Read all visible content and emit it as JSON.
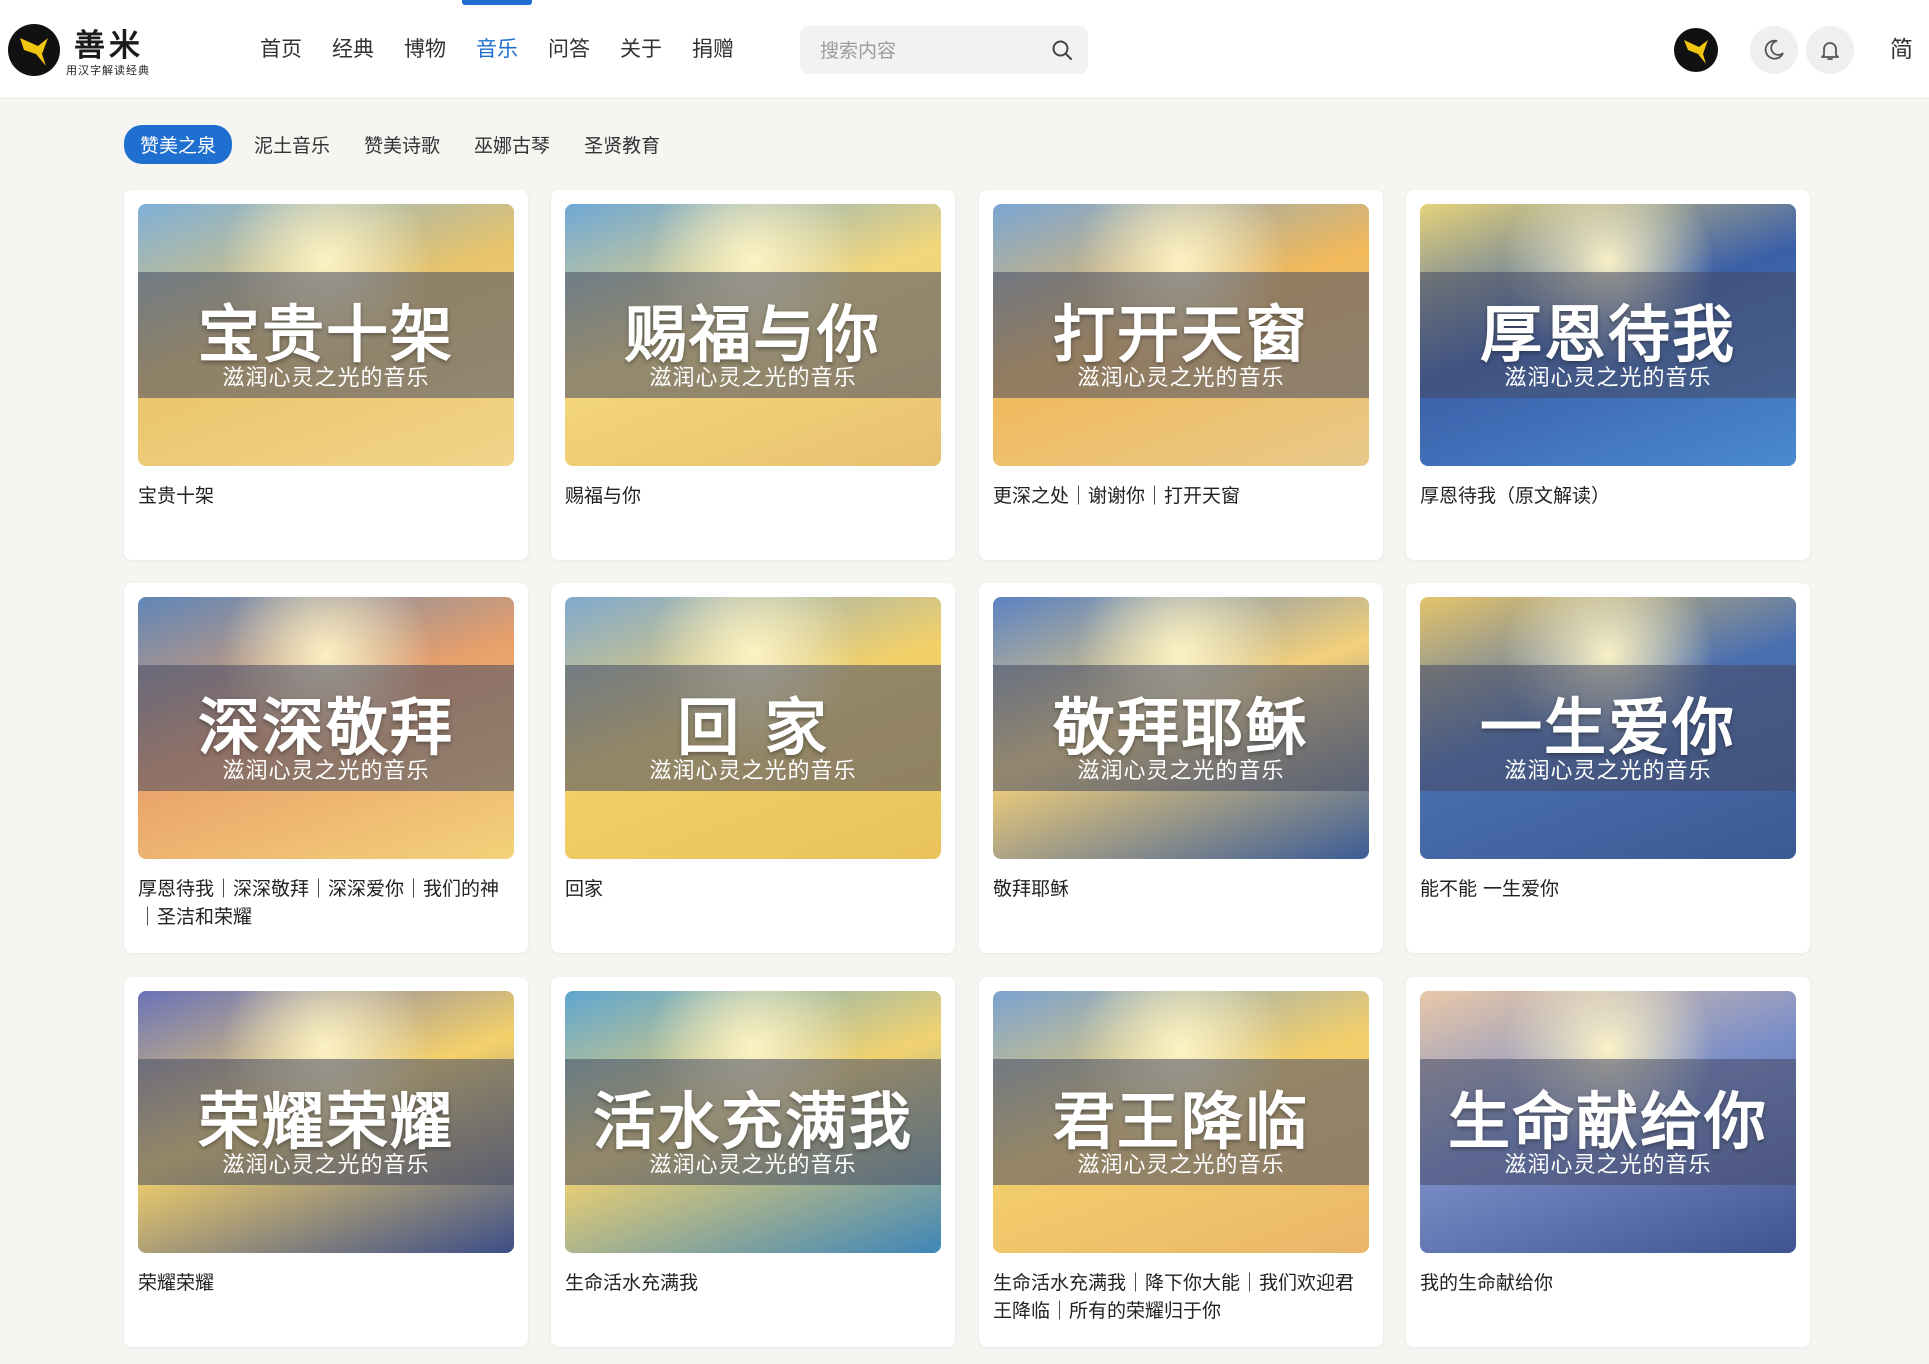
{
  "header": {
    "brand_name": "善米",
    "brand_sub": "用汉字解读经典",
    "nav": [
      "首页",
      "经典",
      "博物",
      "音乐",
      "问答",
      "关于",
      "捐赠"
    ],
    "active_nav_index": 3,
    "search_placeholder": "搜索内容",
    "lang_label": "简"
  },
  "subtabs": [
    "赞美之泉",
    "泥土音乐",
    "赞美诗歌",
    "巫娜古琴",
    "圣贤教育"
  ],
  "active_subtab_index": 0,
  "cover_subtitle": "滋润心灵之光的音乐",
  "cards": [
    {
      "cover_title": "宝贵十架",
      "caption": "宝贵十架",
      "palette": [
        "#e9c46a",
        "#7fb0d8",
        "#f2d48a"
      ]
    },
    {
      "cover_title": "赐福与你",
      "caption": "赐福与你",
      "palette": [
        "#f4d77a",
        "#6fa8d6",
        "#e8c070"
      ]
    },
    {
      "cover_title": "打开天窗",
      "caption": "更深之处｜谢谢你｜打开天窗",
      "palette": [
        "#f1b95a",
        "#7aa6d4",
        "#e8c98a"
      ]
    },
    {
      "cover_title": "厚恩待我",
      "caption": "厚恩待我（原文解读）",
      "palette": [
        "#3b5fa8",
        "#e5d27a",
        "#4a8ad0"
      ]
    },
    {
      "cover_title": "深深敬拜",
      "caption": "厚恩待我｜深深敬拜｜深深爱你｜我们的神｜圣洁和荣耀",
      "palette": [
        "#e9a06a",
        "#5f86b8",
        "#f3d27a"
      ]
    },
    {
      "cover_title": "回 家",
      "caption": "回家",
      "palette": [
        "#f2d06a",
        "#7fa9cf",
        "#e9c25a"
      ]
    },
    {
      "cover_title": "敬拜耶稣",
      "caption": "敬拜耶稣",
      "palette": [
        "#f3d07a",
        "#5b82c2",
        "#3c5c96"
      ]
    },
    {
      "cover_title": "一生爱你",
      "caption": "能不能 一生爱你",
      "palette": [
        "#4a6fb0",
        "#e5c46a",
        "#3a5a92"
      ]
    },
    {
      "cover_title": "荣耀荣耀",
      "caption": "荣耀荣耀",
      "palette": [
        "#f4d16a",
        "#6a72b8",
        "#3c4e88"
      ]
    },
    {
      "cover_title": "活水充满我",
      "caption": "生命活水充满我",
      "palette": [
        "#f1d270",
        "#5fa6d0",
        "#3f86b8"
      ]
    },
    {
      "cover_title": "君王降临",
      "caption": "生命活水充满我｜降下你大能｜我们欢迎君王降临｜所有的荣耀归于你",
      "palette": [
        "#f4cf6a",
        "#7aa2d0",
        "#e9b66a"
      ]
    },
    {
      "cover_title": "生命献给你",
      "caption": "我的生命献给你",
      "palette": [
        "#7a8ec8",
        "#e9c8a8",
        "#3f5390"
      ]
    }
  ]
}
